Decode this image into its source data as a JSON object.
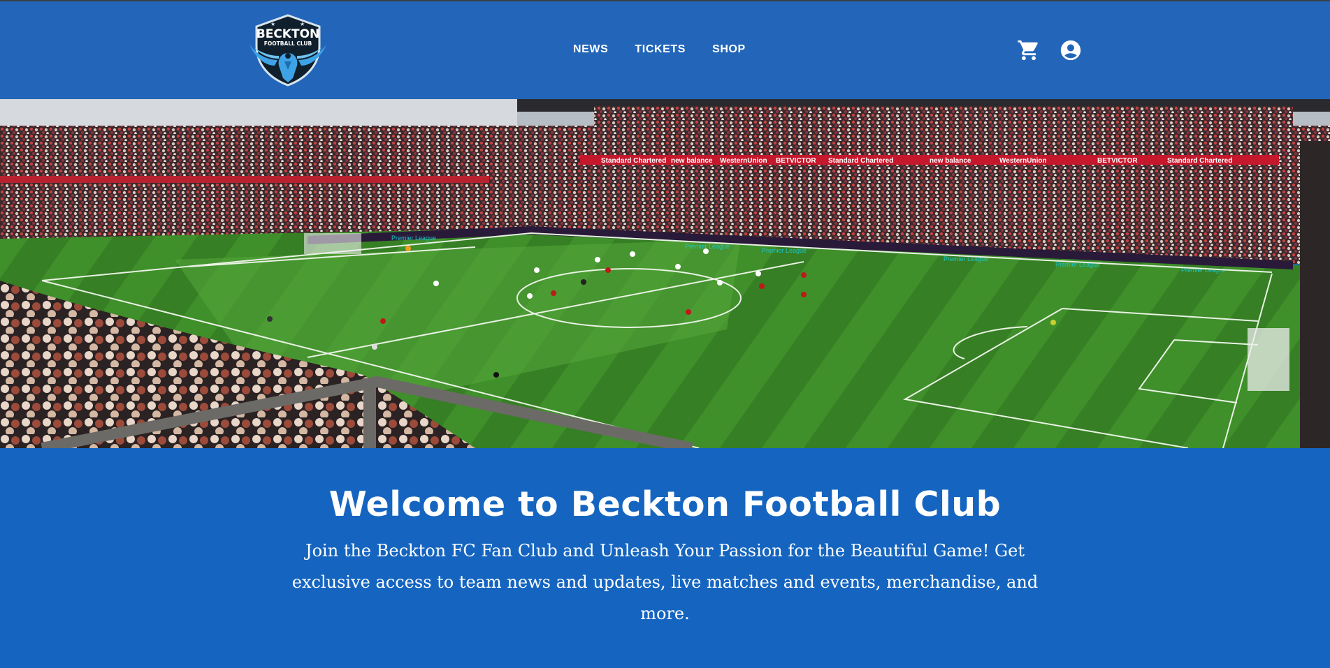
{
  "brand": {
    "logo_line1": "BECKTON",
    "logo_line2": "FOOTBALL CLUB"
  },
  "nav": {
    "items": [
      {
        "label": "NEWS"
      },
      {
        "label": "TICKETS"
      },
      {
        "label": "SHOP"
      }
    ]
  },
  "header_icons": [
    "cart-icon",
    "account-icon"
  ],
  "hero": {
    "banners": [
      "Standard Chartered",
      "new balance",
      "WesternUnion",
      "BETVICTOR",
      "Standard Chartered",
      "new balance",
      "WesternUnion",
      "BETVICTOR",
      "Standard Chartered"
    ],
    "boards": [
      "Premier League",
      "Premier League",
      "Premier League",
      "Premier League",
      "Premier League",
      "Premier League"
    ]
  },
  "welcome": {
    "title": "Welcome to Beckton Football Club",
    "body": "Join the Beckton FC Fan Club and Unleash Your Passion for the Beautiful Game! Get exclusive access to team news and updates, live matches and events, merchandise, and more."
  },
  "colors": {
    "header_bg": "#2366b9",
    "page_bg": "#1565c0",
    "logo_accent": "#3ea3e6",
    "text": "#ffffff"
  }
}
